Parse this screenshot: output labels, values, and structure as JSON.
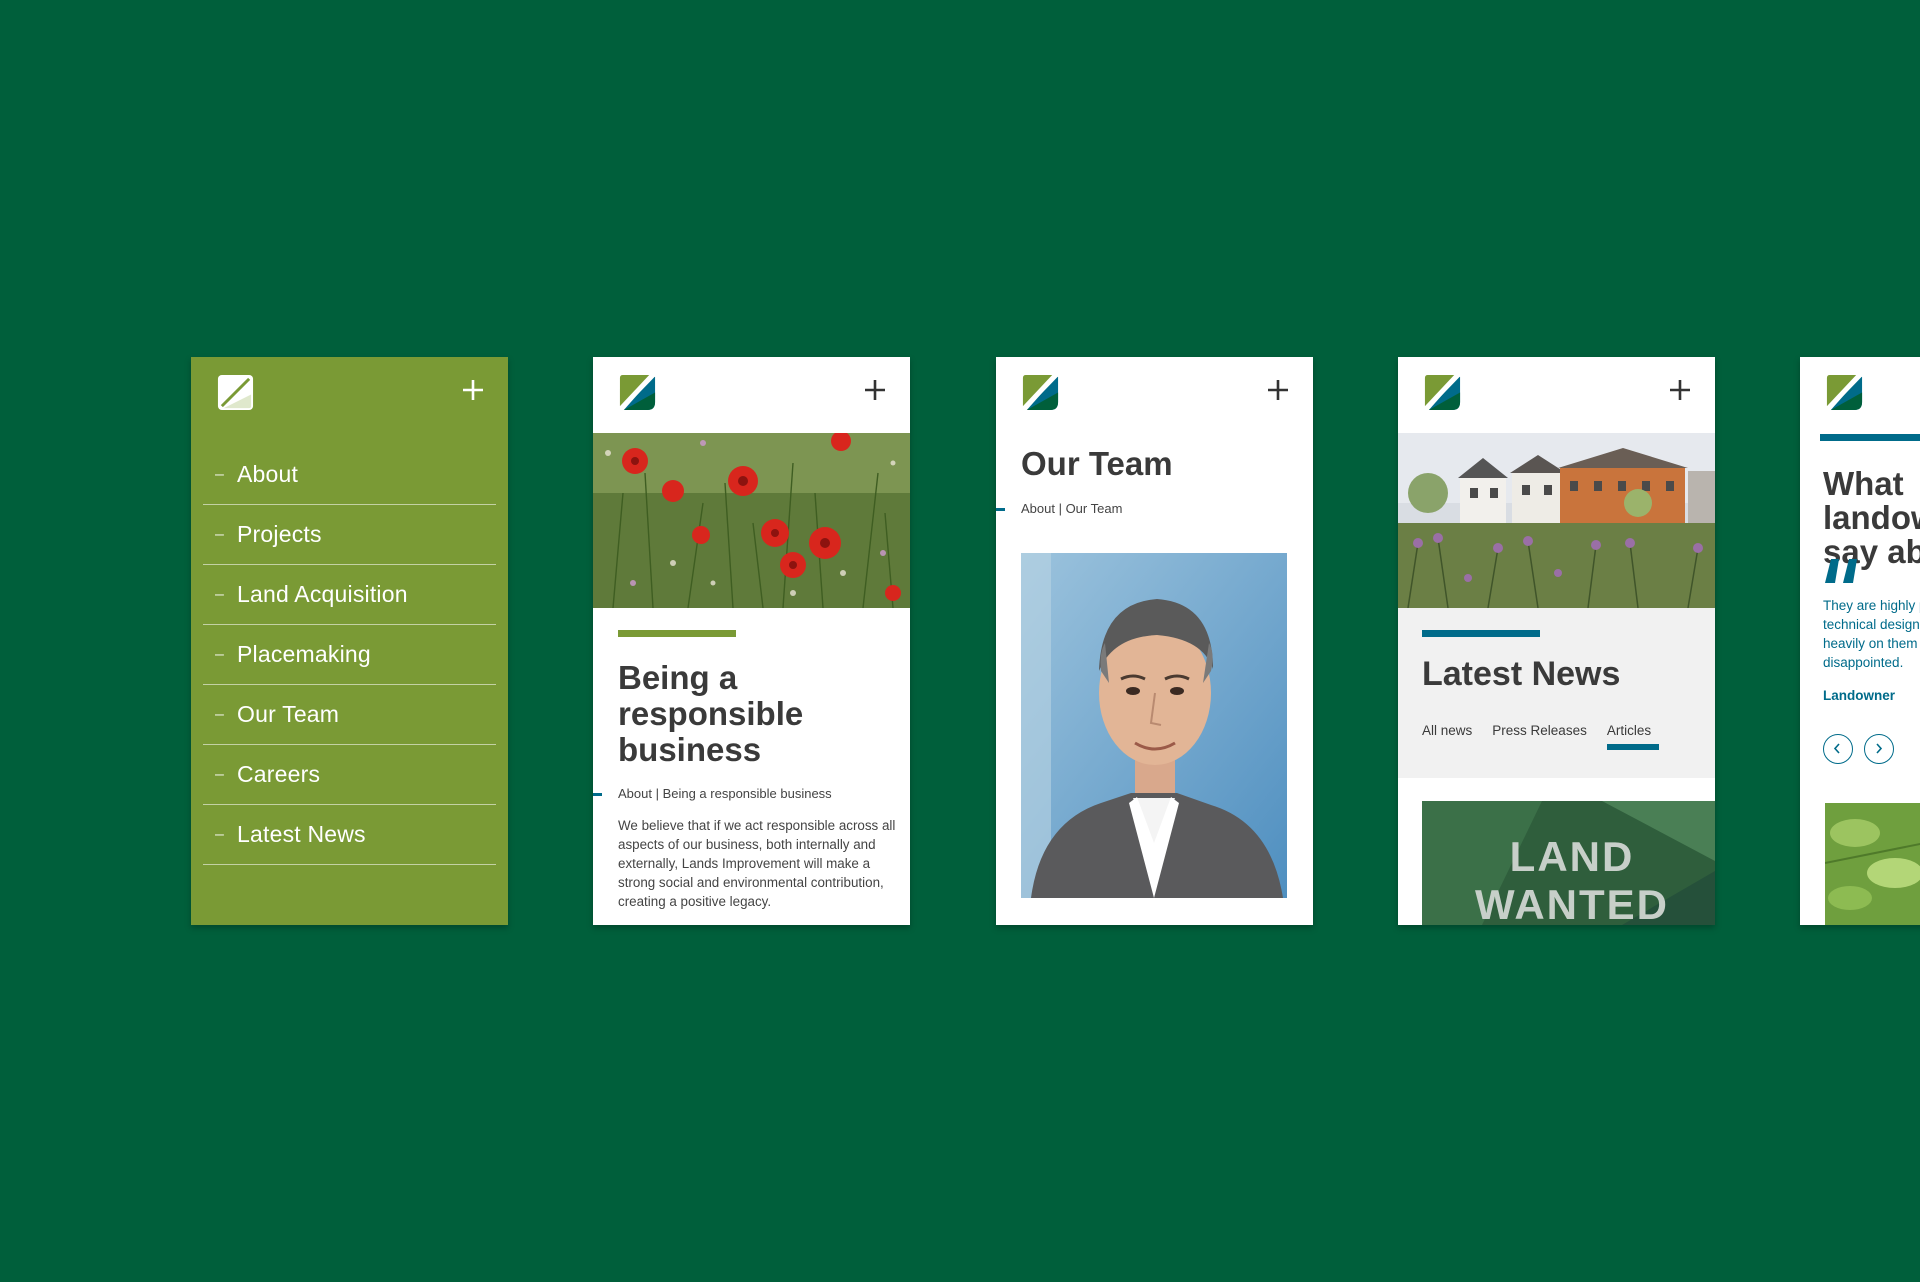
{
  "colors": {
    "background": "#005f3b",
    "brand_green": "#7a9a35",
    "brand_teal": "#006b8a",
    "heading": "#3a3a3a"
  },
  "icons": {
    "logo": "leaf-logo-icon",
    "menu_toggle": "plus-icon",
    "quote": "quote-mark-icon",
    "prev": "chevron-left-icon",
    "next": "chevron-right-icon"
  },
  "menu_screen": {
    "items": [
      {
        "label": "About"
      },
      {
        "label": "Projects"
      },
      {
        "label": "Land Acquisition"
      },
      {
        "label": "Placemaking"
      },
      {
        "label": "Our Team"
      },
      {
        "label": "Careers"
      },
      {
        "label": "Latest News"
      }
    ]
  },
  "responsible_screen": {
    "title": "Being a responsible business",
    "breadcrumb": "About | Being a responsible business",
    "body": "We believe that if we act responsible across all aspects of our business, both internally and externally, Lands Improvement will make a strong social and environmental contribution, creating a positive legacy."
  },
  "team_screen": {
    "title": "Our Team",
    "breadcrumb": "About | Our Team"
  },
  "news_screen": {
    "title": "Latest News",
    "tabs": [
      {
        "label": "All news",
        "active": false
      },
      {
        "label": "Press Releases",
        "active": false
      },
      {
        "label": "Articles",
        "active": true
      }
    ],
    "image_text": "LAND WANTED"
  },
  "quote_screen": {
    "title": "What landowners say about us",
    "quote": "They are highly professional, their technical design capabilities we relied heavily on them and were never disappointed.",
    "author": "Landowner"
  }
}
